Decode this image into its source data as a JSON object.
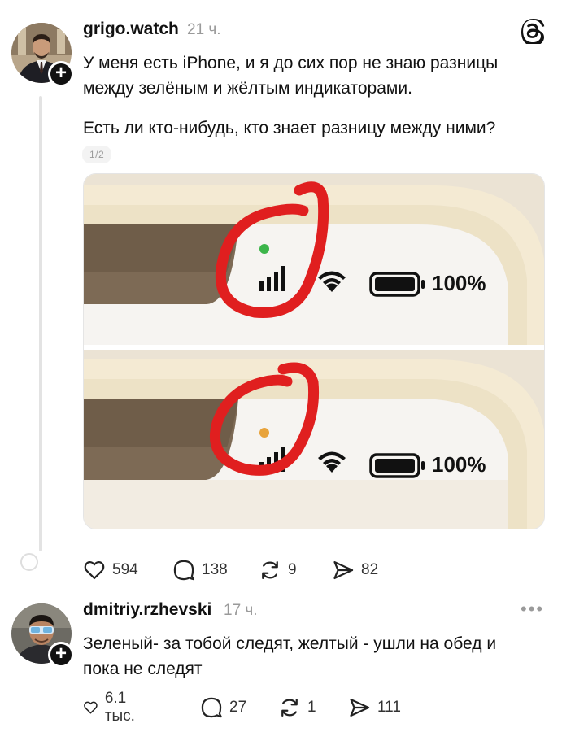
{
  "app": {
    "logo_icon": "threads-logo-icon"
  },
  "post": {
    "username": "grigo.watch",
    "time": "21 ч.",
    "text_line1": "У меня есть iPhone, и я до сих пор не знаю разницы",
    "text_line2": "между зелёным и жёлтым индикаторами.",
    "text_line3": "Есть ли кто-нибудь, кто знает разницу между ними?",
    "image_counter": "1/2",
    "image": {
      "top_panel": {
        "indicator": "green",
        "indicator_color": "#3cb54a",
        "battery_label": "100%"
      },
      "bottom_panel": {
        "indicator": "orange",
        "indicator_color": "#e8a33b",
        "battery_label": "100%"
      },
      "annotation_color": "#e01f1f"
    },
    "likes": "594",
    "comments": "138",
    "reposts": "9",
    "shares": "82"
  },
  "reply": {
    "username": "dmitriy.rzhevski",
    "time": "17 ч.",
    "text_line1": "Зеленый- за тобой следят, желтый - ушли на обед и",
    "text_line2": "пока не следят",
    "likes": "6.1 тыс.",
    "comments": "27",
    "reposts": "1",
    "shares": "111"
  }
}
